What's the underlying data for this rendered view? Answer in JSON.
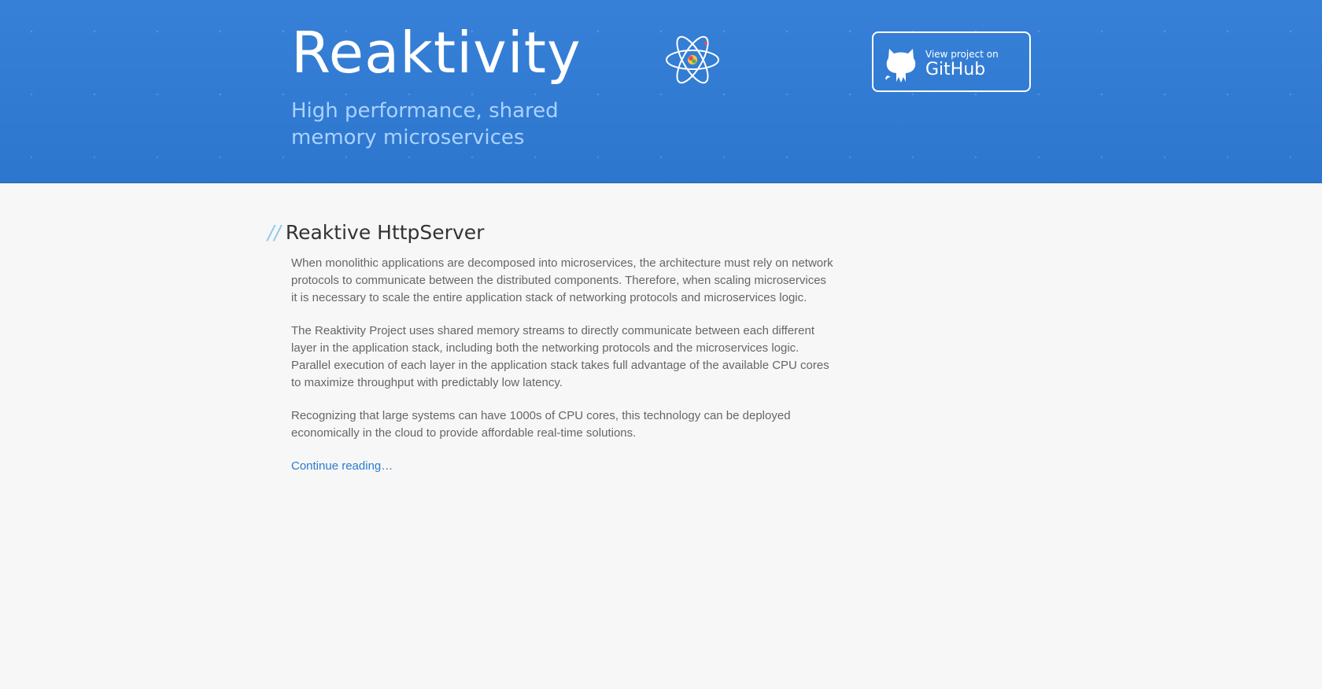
{
  "header": {
    "title": "Reaktivity",
    "tagline": "High performance, shared memory microservices",
    "logo": "atom-logo-icon",
    "github_button": {
      "small_label": "View project on",
      "big_label": "GitHub",
      "icon": "octocat-icon"
    }
  },
  "main": {
    "section_prefix": "//",
    "section_title": "Reaktive HttpServer",
    "paragraphs": [
      "When monolithic applications are decomposed into microservices, the architecture must rely on network protocols to communicate between the distributed components. Therefore, when scaling microservices it is necessary to scale the entire application stack of networking protocols and microservices logic.",
      "The Reaktivity Project uses shared memory streams to directly communicate between each different layer in the application stack, including both the networking protocols and the microservices logic. Parallel execution of each layer in the application stack takes full advantage of the available CPU cores to maximize throughput with predictably low latency.",
      "Recognizing that large systems can have 1000s of CPU cores, this technology can be deployed economically in the cloud to provide affordable real-time solutions."
    ],
    "continue_link": "Continue reading…"
  },
  "colors": {
    "header_bg": "#2f7bd6",
    "tagline": "#a9d2ff",
    "link": "#2b7bd0",
    "slashes": "#8ccaf0"
  }
}
